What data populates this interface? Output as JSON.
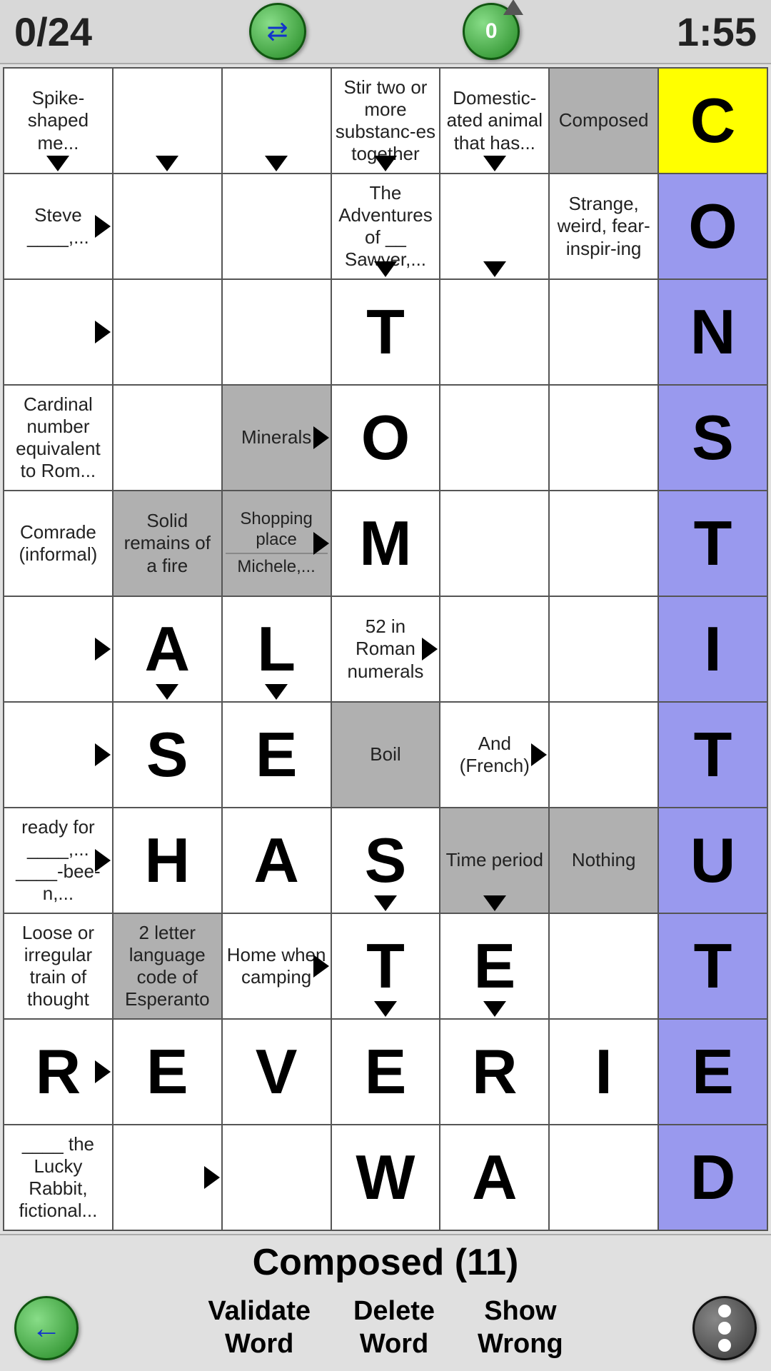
{
  "header": {
    "score": "0/24",
    "timer": "1:55",
    "swap_label": "swap",
    "zero_label": "0"
  },
  "clue_bar": {
    "current_clue": "Composed (11)"
  },
  "footer": {
    "validate_label": "Validate\nWord",
    "delete_label": "Delete\nWord",
    "show_wrong_label": "Show\nWrong"
  },
  "grid": {
    "rows": [
      [
        {
          "type": "clue",
          "text": "Spike-shaped me...",
          "bg": "white",
          "arrow": "down"
        },
        {
          "type": "clue",
          "text": "",
          "bg": "white",
          "arrow": "down"
        },
        {
          "type": "clue",
          "text": "",
          "bg": "white",
          "arrow": "down"
        },
        {
          "type": "clue",
          "text": "Stir two or more substanc-es together",
          "bg": "white",
          "arrow": "down"
        },
        {
          "type": "clue",
          "text": "Domestic-ated animal that has...",
          "bg": "white",
          "arrow": "down"
        },
        {
          "type": "clue",
          "text": "Composed",
          "bg": "gray"
        },
        {
          "type": "letter",
          "letter": "C",
          "bg": "yellow"
        }
      ],
      [
        {
          "type": "clue",
          "text": "Steve ____,...",
          "bg": "white",
          "arrow": "right"
        },
        {
          "type": "empty",
          "bg": "white"
        },
        {
          "type": "empty",
          "bg": "white"
        },
        {
          "type": "clue",
          "text": "The Adventures of __ Sawyer,...",
          "bg": "white",
          "arrow": "down"
        },
        {
          "type": "clue",
          "text": "",
          "bg": "white",
          "arrow": "down"
        },
        {
          "type": "clue",
          "text": "Strange, weird, fear-inspir-ing",
          "bg": "white"
        },
        {
          "type": "letter",
          "letter": "O",
          "bg": "purple"
        }
      ],
      [
        {
          "type": "clue",
          "text": "",
          "bg": "white",
          "arrow": "right"
        },
        {
          "type": "empty",
          "bg": "white"
        },
        {
          "type": "empty",
          "bg": "white"
        },
        {
          "type": "letter",
          "letter": "T",
          "bg": "white"
        },
        {
          "type": "empty",
          "bg": "white"
        },
        {
          "type": "empty",
          "bg": "white"
        },
        {
          "type": "letter",
          "letter": "N",
          "bg": "purple"
        }
      ],
      [
        {
          "type": "clue",
          "text": "Cardinal number equivalent to Rom...",
          "bg": "white"
        },
        {
          "type": "empty",
          "bg": "white"
        },
        {
          "type": "clue",
          "text": "Minerals",
          "bg": "gray",
          "arrow": "right"
        },
        {
          "type": "letter",
          "letter": "O",
          "bg": "white"
        },
        {
          "type": "empty",
          "bg": "white"
        },
        {
          "type": "empty",
          "bg": "white"
        },
        {
          "type": "letter",
          "letter": "S",
          "bg": "purple"
        }
      ],
      [
        {
          "type": "clue",
          "text": "Comrade (informal)",
          "bg": "white"
        },
        {
          "type": "clue",
          "text": "Solid remains of a fire",
          "bg": "gray"
        },
        {
          "type": "split",
          "top": "Shopping place",
          "bottom": "Michele,...",
          "bg": "gray",
          "arrow": "right"
        },
        {
          "type": "letter",
          "letter": "M",
          "bg": "white"
        },
        {
          "type": "empty",
          "bg": "white"
        },
        {
          "type": "empty",
          "bg": "white"
        },
        {
          "type": "letter",
          "letter": "T",
          "bg": "purple"
        }
      ],
      [
        {
          "type": "clue",
          "text": "",
          "bg": "white",
          "arrow": "right"
        },
        {
          "type": "letter",
          "letter": "A",
          "bg": "white",
          "arrow": "down"
        },
        {
          "type": "letter",
          "letter": "L",
          "bg": "white",
          "arrow": "down"
        },
        {
          "type": "clue",
          "text": "52 in Roman numerals",
          "bg": "white",
          "arrow": "right"
        },
        {
          "type": "empty",
          "bg": "white"
        },
        {
          "type": "empty",
          "bg": "white"
        },
        {
          "type": "letter",
          "letter": "I",
          "bg": "purple"
        }
      ],
      [
        {
          "type": "clue",
          "text": "",
          "bg": "white",
          "arrow": "right"
        },
        {
          "type": "letter",
          "letter": "S",
          "bg": "white"
        },
        {
          "type": "letter",
          "letter": "E",
          "bg": "white"
        },
        {
          "type": "clue",
          "text": "Boil",
          "bg": "gray"
        },
        {
          "type": "clue",
          "text": "And (French)",
          "bg": "white",
          "arrow": "right"
        },
        {
          "type": "empty",
          "bg": "white"
        },
        {
          "type": "letter",
          "letter": "T",
          "bg": "purple"
        }
      ],
      [
        {
          "type": "clue",
          "text": "ready for ____,...\n____-bee-n,...",
          "bg": "white",
          "arrow": "right"
        },
        {
          "type": "letter",
          "letter": "H",
          "bg": "white"
        },
        {
          "type": "letter",
          "letter": "A",
          "bg": "white"
        },
        {
          "type": "letter",
          "letter": "S",
          "bg": "white",
          "arrow": "down"
        },
        {
          "type": "clue",
          "text": "Time period",
          "bg": "gray",
          "arrow": "down"
        },
        {
          "type": "clue",
          "text": "Nothing",
          "bg": "gray"
        },
        {
          "type": "letter",
          "letter": "U",
          "bg": "purple"
        }
      ],
      [
        {
          "type": "clue",
          "text": "Loose or irregular train of thought",
          "bg": "white"
        },
        {
          "type": "clue",
          "text": "2 letter language code of Esperanto",
          "bg": "gray"
        },
        {
          "type": "clue",
          "text": "Home when camping",
          "bg": "white",
          "arrow": "right"
        },
        {
          "type": "letter",
          "letter": "T",
          "bg": "white",
          "arrow": "down"
        },
        {
          "type": "letter",
          "letter": "E",
          "bg": "white",
          "arrow": "down"
        },
        {
          "type": "empty",
          "bg": "white"
        },
        {
          "type": "letter",
          "letter": "T",
          "bg": "purple"
        }
      ],
      [
        {
          "type": "letter",
          "letter": "R",
          "bg": "white",
          "arrow": "right"
        },
        {
          "type": "letter",
          "letter": "E",
          "bg": "white"
        },
        {
          "type": "letter",
          "letter": "V",
          "bg": "white"
        },
        {
          "type": "letter",
          "letter": "E",
          "bg": "white"
        },
        {
          "type": "letter",
          "letter": "R",
          "bg": "white"
        },
        {
          "type": "letter",
          "letter": "I",
          "bg": "white"
        },
        {
          "type": "letter",
          "letter": "E",
          "bg": "purple"
        }
      ],
      [
        {
          "type": "clue",
          "text": "____ the Lucky Rabbit, fictional...",
          "bg": "white"
        },
        {
          "type": "empty",
          "bg": "white",
          "arrow": "right"
        },
        {
          "type": "empty",
          "bg": "white"
        },
        {
          "type": "letter",
          "letter": "W",
          "bg": "white"
        },
        {
          "type": "letter",
          "letter": "A",
          "bg": "white"
        },
        {
          "type": "empty",
          "bg": "white"
        },
        {
          "type": "letter",
          "letter": "D",
          "bg": "purple"
        }
      ]
    ]
  }
}
